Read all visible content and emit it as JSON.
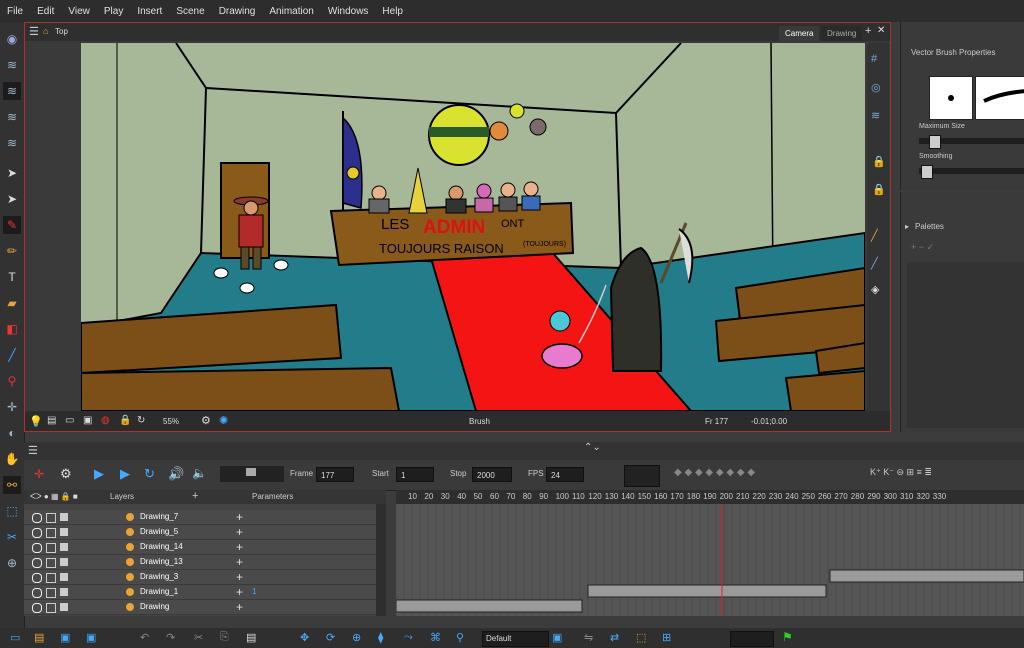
{
  "menu": [
    "File",
    "Edit",
    "View",
    "Play",
    "Insert",
    "Scene",
    "Drawing",
    "Animation",
    "Windows",
    "Help"
  ],
  "camera_view": {
    "view_label": "Top",
    "tabs": [
      "Camera",
      "Drawing"
    ],
    "zoom": "55%",
    "tool_name": "Brush",
    "frame_readout": "Fr 177",
    "coord_readout": "-0.01;0.00"
  },
  "artwork_text": {
    "banner_line1_a": "LES",
    "banner_line1_b": "ADMIN",
    "banner_line1_c": "ONT",
    "banner_line2": "TOUJOURS RAISON",
    "banner_aside": "(TOUJOURS)"
  },
  "properties": {
    "title": "Vector Brush Properties",
    "max_size_label": "Maximum Size",
    "smoothing_label": "Smoothing"
  },
  "palettes": {
    "title": "Palettes"
  },
  "timeline": {
    "frame_label": "Frame",
    "frame_value": "177",
    "start_label": "Start",
    "start_value": "1",
    "stop_label": "Stop",
    "stop_value": "2000",
    "fps_label": "FPS",
    "fps_value": "24",
    "layers_header": "Layers",
    "parameters_header": "Parameters",
    "ruler": [
      "10",
      "20",
      "30",
      "40",
      "50",
      "60",
      "70",
      "80",
      "90",
      "100",
      "110",
      "120",
      "130",
      "140",
      "150",
      "160",
      "170",
      "180",
      "190",
      "200",
      "210",
      "220",
      "230",
      "240",
      "250",
      "260",
      "270",
      "280",
      "290",
      "300",
      "310",
      "320",
      "330"
    ],
    "layers": [
      {
        "name": "Drawing_7",
        "param": ""
      },
      {
        "name": "Drawing_5",
        "param": ""
      },
      {
        "name": "Drawing_14",
        "param": ""
      },
      {
        "name": "Drawing_13",
        "param": ""
      },
      {
        "name": "Drawing_3",
        "param": ""
      },
      {
        "name": "Drawing_1",
        "param": "1"
      },
      {
        "name": "Drawing",
        "param": ""
      }
    ]
  },
  "bottom_toolbar": {
    "preset_value": "Default"
  }
}
